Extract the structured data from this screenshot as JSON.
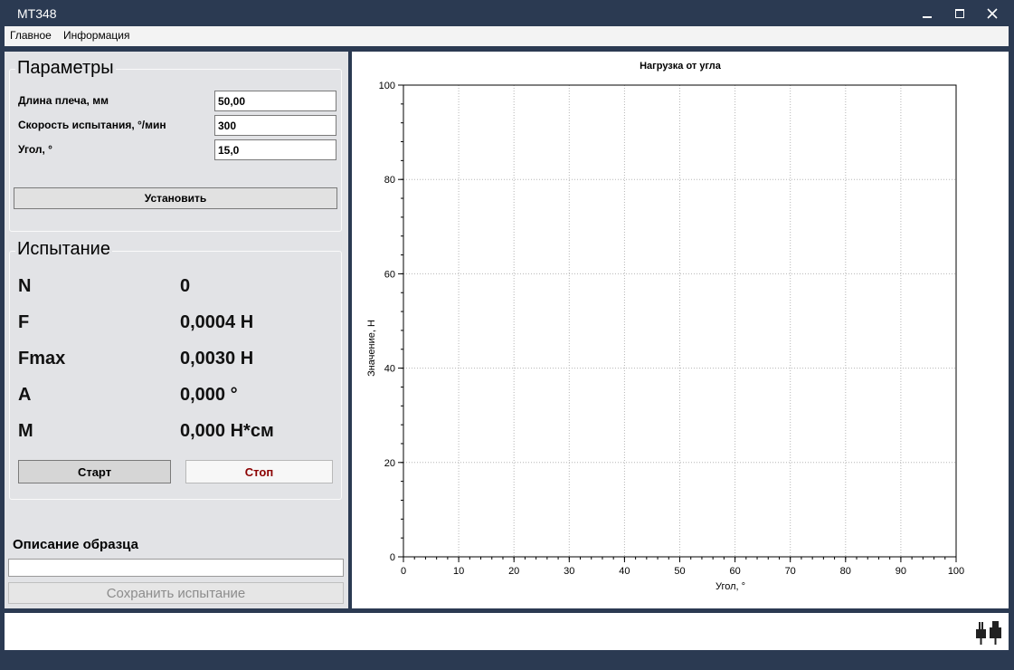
{
  "window": {
    "title": "МТ348"
  },
  "menu": [
    {
      "label": "Главное"
    },
    {
      "label": "Информация"
    }
  ],
  "params": {
    "title": "Параметры",
    "fields": [
      {
        "label": "Длина плеча, мм",
        "value": "50,00"
      },
      {
        "label": "Скорость испытания, °/мин",
        "value": "300"
      },
      {
        "label": "Угол, °",
        "value": "15,0"
      }
    ],
    "set_button": "Установить"
  },
  "test": {
    "title": "Испытание",
    "metrics": [
      {
        "label": "N",
        "value": "0"
      },
      {
        "label": "F",
        "value": "0,0004 Н"
      },
      {
        "label": "Fmax",
        "value": "0,0030 Н"
      },
      {
        "label": "A",
        "value": "0,000 °"
      },
      {
        "label": "M",
        "value": "0,000 Н*см"
      }
    ],
    "start_button": "Старт",
    "stop_button": "Стоп",
    "stop_color": "#8b0000"
  },
  "sample": {
    "title": "Описание образца",
    "value": "",
    "save_button": "Сохранить испытание"
  },
  "chart_data": {
    "type": "line",
    "title": "Нагрузка от угла",
    "xlabel": "Угол, °",
    "ylabel": "Значение, Н",
    "xlim": [
      0,
      100
    ],
    "ylim": [
      0,
      100
    ],
    "xticks": [
      0,
      10,
      20,
      30,
      40,
      50,
      60,
      70,
      80,
      90,
      100
    ],
    "yticks": [
      0,
      20,
      40,
      60,
      80,
      100
    ],
    "grid": true,
    "series": []
  },
  "status": {
    "connection_icon": "plug-icon"
  }
}
